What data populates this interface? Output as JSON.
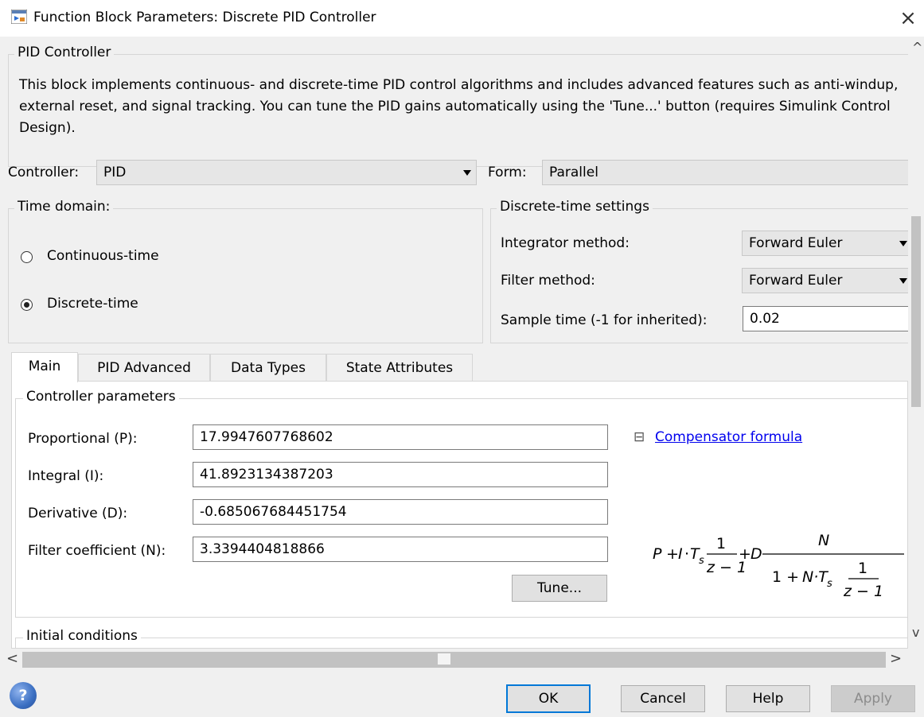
{
  "window": {
    "title": "Function Block Parameters: Discrete PID Controller",
    "close_glyph": "×"
  },
  "block": {
    "group_title": "PID Controller",
    "description": "This block implements continuous- and discrete-time PID control algorithms and includes advanced features such as anti-windup, external reset, and signal tracking. You can tune the PID gains automatically using the 'Tune...' button (requires Simulink Control Design)."
  },
  "controller": {
    "label": "Controller:",
    "value": "PID"
  },
  "form": {
    "label": "Form:",
    "value": "Parallel"
  },
  "time_domain": {
    "title": "Time domain:",
    "options": [
      "Continuous-time",
      "Discrete-time"
    ],
    "selected": "Discrete-time"
  },
  "discrete_settings": {
    "title": "Discrete-time settings",
    "integrator_label": "Integrator method:",
    "integrator_value": "Forward Euler",
    "filter_label": "Filter method:",
    "filter_value": "Forward Euler",
    "sample_label": "Sample time (-1 for inherited):",
    "sample_value": "0.02"
  },
  "tabs": [
    {
      "label": "Main",
      "active": true
    },
    {
      "label": "PID Advanced",
      "active": false
    },
    {
      "label": "Data Types",
      "active": false
    },
    {
      "label": "State Attributes",
      "active": false
    }
  ],
  "controller_params": {
    "title": "Controller parameters",
    "proportional_label": "Proportional (P):",
    "proportional_value": "17.9947607768602",
    "integral_label": "Integral (I):",
    "integral_value": "41.8923134387203",
    "derivative_label": "Derivative (D):",
    "derivative_value": "-0.685067684451754",
    "filter_label": "Filter coefficient (N):",
    "filter_value": "3.3394404818866",
    "tune_label": "Tune..."
  },
  "compensator": {
    "collapse_glyph": "⊟",
    "link_label": "Compensator formula",
    "formula": {
      "p": "P",
      "plus": "+",
      "i": "I",
      "dot": "·",
      "t": "T",
      "s": "s",
      "one": "1",
      "z_minus_1": "z − 1",
      "d": "D",
      "n": "N",
      "one_plus": "1 + ",
      "n_t": "N·T"
    }
  },
  "initial_conditions": {
    "title": "Initial conditions"
  },
  "scroll": {
    "up": "^",
    "down": "v",
    "left": "<",
    "right": ">"
  },
  "buttons": {
    "ok": "OK",
    "cancel": "Cancel",
    "help": "Help",
    "apply": "Apply",
    "help_icon_glyph": "?"
  },
  "colors": {
    "accent": "#0078d7",
    "link": "#0000ee",
    "help_icon": "#3b6fc2"
  }
}
